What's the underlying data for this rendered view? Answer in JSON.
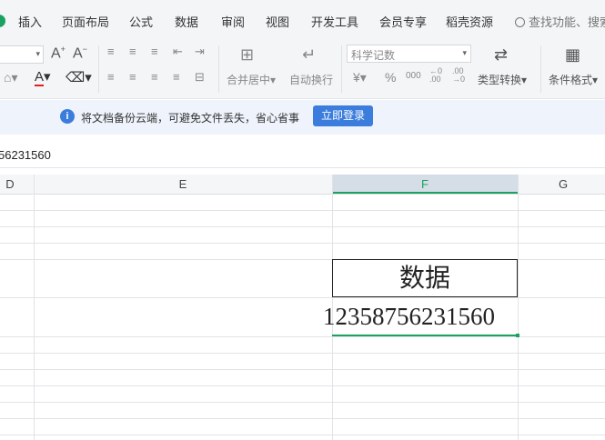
{
  "menu": {
    "items": [
      "插入",
      "页面布局",
      "公式",
      "数据",
      "审阅",
      "视图",
      "开发工具",
      "会员专享",
      "稻壳资源"
    ],
    "search_placeholder": "查找功能、搜索"
  },
  "ribbon": {
    "merge_center": "合并居中",
    "auto_wrap": "自动换行",
    "number_format": "科学记数",
    "currency_symbol": "¥",
    "percent_symbol": "%",
    "thousands_symbol": "000",
    "type_convert": "类型转换",
    "conditional_format": "条件格式"
  },
  "notice": {
    "text": "将文档备份云端，可避免文件丢失，省心省事",
    "login_button": "立即登录"
  },
  "formula_bar": {
    "value": "56231560"
  },
  "columns": [
    "D",
    "E",
    "F",
    "G"
  ],
  "cells": {
    "f_header": "数据",
    "f_value": "12358756231560"
  },
  "colors": {
    "accent": "#1aa260",
    "brand_blue": "#3b7ddd",
    "notice_bg": "#eef3fc"
  }
}
